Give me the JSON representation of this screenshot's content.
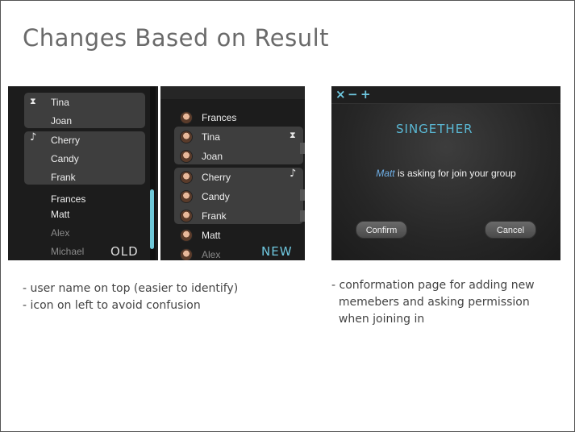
{
  "slide": {
    "title": "Changes Based on Result"
  },
  "old_list": {
    "label": "OLD",
    "group1": [
      {
        "name": "Tina",
        "icon": "hourglass-icon",
        "glyph": "⧗"
      },
      {
        "name": "Joan"
      }
    ],
    "group2": [
      {
        "name": "Cherry",
        "icon": "music-note-icon",
        "glyph": "♪"
      },
      {
        "name": "Candy"
      },
      {
        "name": "Frank"
      }
    ],
    "loose": [
      {
        "name": "Frances"
      },
      {
        "name": "Matt"
      },
      {
        "name": "Alex"
      },
      {
        "name": "Michael"
      }
    ]
  },
  "new_list": {
    "label": "NEW",
    "items": [
      {
        "name": "Frances"
      },
      {
        "name": "Tina",
        "glyph": "⧗"
      },
      {
        "name": "Joan"
      },
      {
        "name": "Cherry",
        "glyph": "♪"
      },
      {
        "name": "Candy"
      },
      {
        "name": "Frank"
      },
      {
        "name": "Matt"
      },
      {
        "name": "Alex"
      }
    ]
  },
  "dialog": {
    "controls": {
      "close": "×",
      "minimize": "−",
      "maximize": "+"
    },
    "logo": "SINGETHER",
    "requester": "Matt",
    "message_rest": " is asking for join your group",
    "confirm_label": "Confirm",
    "cancel_label": "Cancel"
  },
  "notes_left": [
    "- user name on top (easier to identify)",
    "- icon on left to avoid confusion"
  ],
  "notes_right": [
    "- conformation page for adding new",
    "  memebers and asking permission",
    "  when joining in"
  ],
  "colors": {
    "accent": "#6fc8e0",
    "panel_bg": "#1c1c1c",
    "group_bg": "#3e3e3e"
  }
}
